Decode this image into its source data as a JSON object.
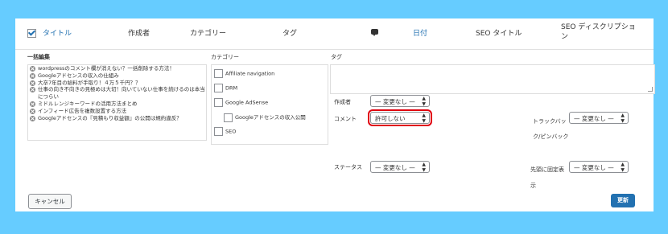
{
  "header": {
    "title": "タイトル",
    "author": "作成者",
    "category": "カテゴリー",
    "tag": "タグ",
    "date": "日付",
    "seo_title": "SEO タイトル",
    "seo_description": "SEO ディスクリプション"
  },
  "bulk_edit": {
    "label": "一括編集",
    "posts": [
      "wordpressのコメント欄が消えない？一括削除する方法！",
      "Googleアドセンスの収入の仕組み",
      "大卒7年目の給料が手取り！４万５千円？？",
      "仕事の向き不向きの見極めは大切！向いていない仕事を続けるのは本当につらい",
      "ミドルレンジキーワードの活用方法まとめ",
      "インフィード広告を複数設置する方法",
      "Googleアドセンスの『見積もり収益額』の公開は規約違反？"
    ]
  },
  "categories": {
    "label": "カテゴリー",
    "items": [
      "Affiliate navigation",
      "DRM",
      "Google AdSense",
      "Googleアドセンスの収入公開",
      "SEO"
    ]
  },
  "tags": {
    "label": "タグ",
    "value": ""
  },
  "fields": {
    "author_label": "作成者",
    "author_value": "— 変更なし —",
    "comment_label": "コメント",
    "comment_value": "許可しない",
    "trackback_label": "トラックバック/ピンバック",
    "trackback_value": "— 変更なし —",
    "status_label": "ステータス",
    "status_value": "— 変更なし —",
    "sticky_label": "先頭に固定表示",
    "sticky_value": "— 変更なし —"
  },
  "buttons": {
    "cancel": "キャンセル",
    "update": "更新"
  },
  "colors": {
    "background": "#66ccff",
    "accent": "#2271b1",
    "highlight": "#e0000f"
  }
}
